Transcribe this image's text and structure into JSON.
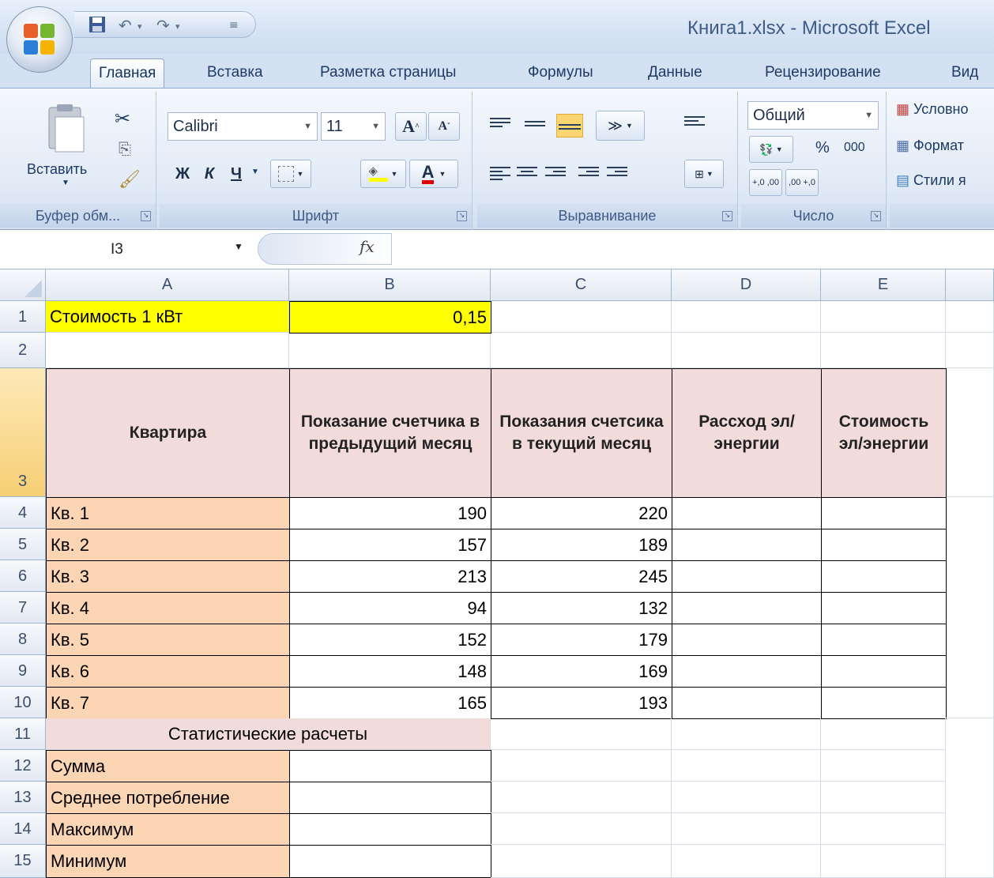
{
  "app": {
    "window_title": "Книга1.xlsx - Microsoft Excel"
  },
  "tabs": [
    "Главная",
    "Вставка",
    "Разметка страницы",
    "Формулы",
    "Данные",
    "Рецензирование",
    "Вид"
  ],
  "ribbon": {
    "clipboard": {
      "label": "Буфер обм...",
      "paste_label": "Вставить"
    },
    "font": {
      "label": "Шрифт",
      "font_name": "Calibri",
      "font_size": "11",
      "bold": "Ж",
      "italic": "К",
      "underline": "Ч",
      "font_color_letter": "A"
    },
    "alignment": {
      "label": "Выравнивание"
    },
    "number": {
      "label": "Число",
      "format": "Общий",
      "percent": "%",
      "thousands": "000",
      "inc_decimals": "+,0 ,00",
      "dec_decimals": ",00 +,0"
    },
    "styles": {
      "conditional": "Условно",
      "format_table": "Формат",
      "cell_styles": "Стили я"
    }
  },
  "formula_bar": {
    "name_box": "I3",
    "fx": "fx",
    "value": ""
  },
  "colors": {
    "yellow": "#ffff00",
    "header_pink": "#f2dcdb",
    "label_peach": "#fcd5b4"
  },
  "sheet": {
    "columns": [
      "A",
      "B",
      "C",
      "D",
      "E"
    ],
    "rows": [
      "1",
      "2",
      "3",
      "4",
      "5",
      "6",
      "7",
      "8",
      "9",
      "10",
      "11",
      "12",
      "13",
      "14",
      "15"
    ],
    "r1": {
      "a": "Стоимость 1 кВт",
      "b": "0,15"
    },
    "headers": {
      "a": "Квартира",
      "b": "Показание счетчика в предыдущий месяц",
      "c": "Показания счетсика в текущий месяц",
      "d": "Рассход эл/энергии",
      "e": "Стоимость эл/энергии"
    },
    "data": [
      {
        "apt": "Кв. 1",
        "prev": "190",
        "curr": "220"
      },
      {
        "apt": "Кв. 2",
        "prev": "157",
        "curr": "189"
      },
      {
        "apt": "Кв. 3",
        "prev": "213",
        "curr": "245"
      },
      {
        "apt": "Кв. 4",
        "prev": "94",
        "curr": "132"
      },
      {
        "apt": "Кв. 5",
        "prev": "152",
        "curr": "179"
      },
      {
        "apt": "Кв. 6",
        "prev": "148",
        "curr": "169"
      },
      {
        "apt": "Кв. 7",
        "prev": "165",
        "curr": "193"
      }
    ],
    "stats_title": "Статистические расчеты",
    "stats": [
      "Сумма",
      "Среднее потребление",
      "Максимум",
      "Минимум"
    ]
  }
}
